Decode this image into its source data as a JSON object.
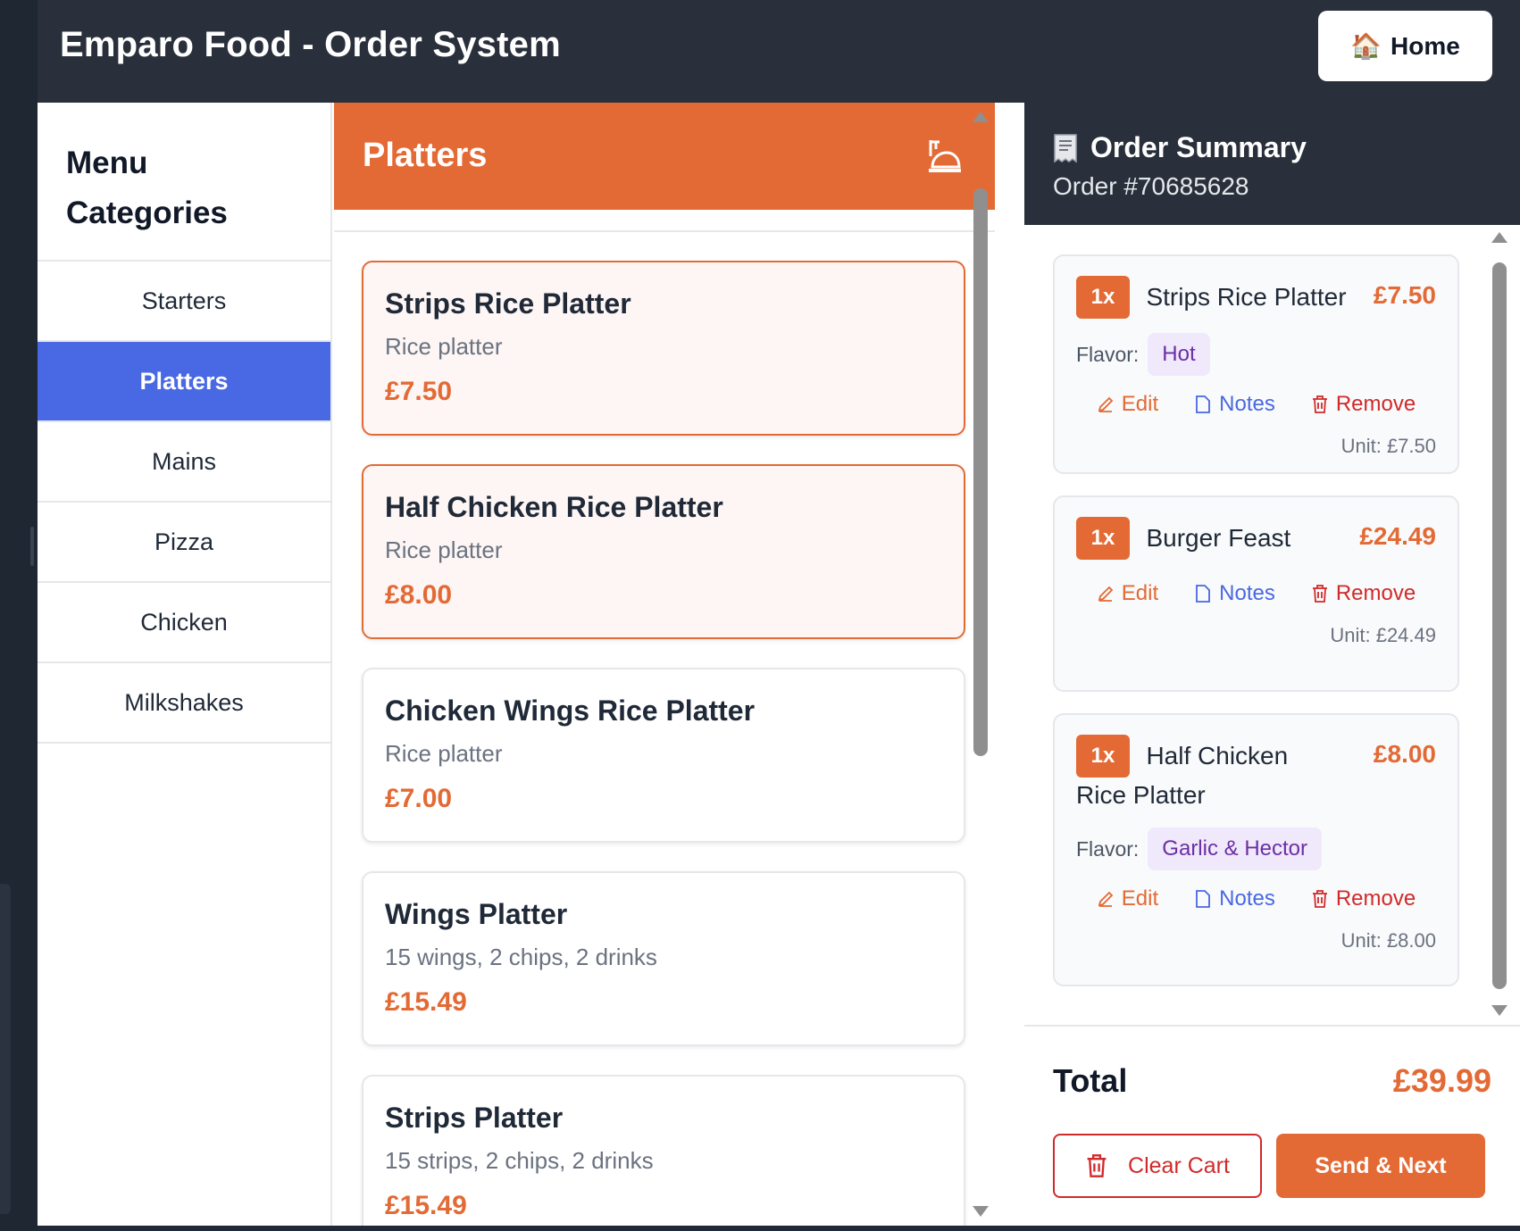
{
  "header": {
    "title": "Emparo Food - Order System",
    "home_label": "Home",
    "home_icon": "house-icon"
  },
  "sidebar": {
    "title": "Menu Categories",
    "categories": [
      {
        "label": "Starters",
        "active": false
      },
      {
        "label": "Platters",
        "active": true
      },
      {
        "label": "Mains",
        "active": false
      },
      {
        "label": "Pizza",
        "active": false
      },
      {
        "label": "Chicken",
        "active": false
      },
      {
        "label": "Milkshakes",
        "active": false
      }
    ]
  },
  "menu": {
    "title": "Platters",
    "icon": "platter-icon",
    "items": [
      {
        "name": "Strips Rice Platter",
        "desc": "Rice platter",
        "price": "£7.50",
        "selected": true
      },
      {
        "name": "Half Chicken Rice Platter",
        "desc": "Rice platter",
        "price": "£8.00",
        "selected": true
      },
      {
        "name": "Chicken Wings Rice Platter",
        "desc": "Rice platter",
        "price": "£7.00",
        "selected": false
      },
      {
        "name": "Wings Platter",
        "desc": "15 wings, 2 chips, 2 drinks",
        "price": "£15.49",
        "selected": false
      },
      {
        "name": "Strips Platter",
        "desc": "15 strips, 2 chips, 2 drinks",
        "price": "£15.49",
        "selected": false
      }
    ]
  },
  "summary": {
    "title": "Order Summary",
    "order_number": "Order #70685628",
    "flavor_label": "Flavor:",
    "edit_label": "Edit",
    "notes_label": "Notes",
    "remove_label": "Remove",
    "cart": [
      {
        "qty": "1x",
        "name": "Strips Rice Platter",
        "price": "£7.50",
        "flavor": "Hot",
        "unit": "Unit: £7.50"
      },
      {
        "qty": "1x",
        "name": "Burger Feast",
        "price": "£24.49",
        "flavor": null,
        "unit": "Unit: £24.49"
      },
      {
        "qty": "1x",
        "name": "Half Chicken Rice Platter",
        "price": "£8.00",
        "flavor": "Garlic & Hector",
        "unit": "Unit: £8.00"
      }
    ],
    "total_label": "Total",
    "total_value": "£39.99",
    "clear_label": "Clear Cart",
    "send_label": "Send & Next"
  },
  "colors": {
    "accent": "#e36a35",
    "active_category": "#4968e3",
    "header_bg": "#29303b",
    "danger": "#d02a2a",
    "flavor_tag_bg": "#efe9fb",
    "flavor_tag_text": "#6b2fa6"
  }
}
